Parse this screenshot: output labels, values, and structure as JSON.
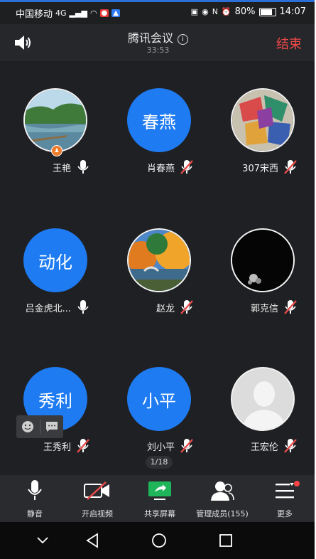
{
  "status_bar": {
    "carrier": "中国移动",
    "network": "4G",
    "battery": "80%",
    "time": "14:07"
  },
  "header": {
    "title": "腾讯会议",
    "timer": "33:53",
    "end_label": "结束"
  },
  "participants": [
    {
      "name": "王艳",
      "avatar_type": "photo-lake",
      "host": true,
      "mic": "on"
    },
    {
      "name": "肖春燕",
      "avatar_type": "text",
      "avatar_text": "春燕",
      "mic": "muted"
    },
    {
      "name": "307宋西",
      "avatar_type": "photo-art",
      "mic": "muted"
    },
    {
      "name": "吕金虎北...",
      "avatar_type": "text",
      "avatar_text": "动化",
      "mic": "on"
    },
    {
      "name": "赵龙",
      "avatar_type": "photo-autumn",
      "mic": "muted"
    },
    {
      "name": "郭克信",
      "avatar_type": "photo-dark",
      "mic": "muted"
    },
    {
      "name": "王秀利",
      "avatar_type": "text",
      "avatar_text": "秀利",
      "mic": "muted"
    },
    {
      "name": "刘小平",
      "avatar_type": "text",
      "avatar_text": "小平",
      "mic": "muted"
    },
    {
      "name": "王宏伦",
      "avatar_type": "default",
      "mic": "muted"
    }
  ],
  "pager": "1/18",
  "toolbar": {
    "mute": "静音",
    "video": "开启视频",
    "share": "共享屏幕",
    "members": "管理成员(155)",
    "more": "更多"
  },
  "colors": {
    "accent_blue": "#1e7bf2",
    "end_red": "#f24949",
    "muted_red": "#e84b4b",
    "share_green": "#1fb55a"
  }
}
